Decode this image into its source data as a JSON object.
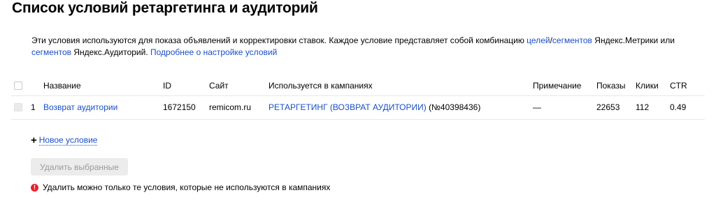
{
  "page": {
    "title": "Список условий ретаргетинга и аудиторий"
  },
  "description": {
    "text1": "Эти условия используются для показа объявлений и корректировки ставок. Каждое условие представляет собой комбинацию ",
    "link_goals": "целей",
    "slash": "/",
    "link_segments_metrika": "сегментов",
    "text2": " Яндекс.Метрики или",
    "link_segments_audience": "сегментов",
    "text3": " Яндекс.Аудиторий. ",
    "link_more": "Подробнее о настройке условий"
  },
  "table": {
    "headers": {
      "name": "Название",
      "id": "ID",
      "site": "Сайт",
      "campaigns": "Используется в кампаниях",
      "note": "Примечание",
      "impressions": "Показы",
      "clicks": "Клики",
      "ctr": "CTR"
    },
    "rows": [
      {
        "num": "1",
        "name": "Возврат аудитории",
        "id": "1672150",
        "site": "remicom.ru",
        "campaign": "РЕТАРГЕТИНГ (ВОЗВРАТ АУДИТОРИИ)",
        "campaign_id": "(№40398436)",
        "note": "—",
        "impressions": "22653",
        "clicks": "112",
        "ctr": "0.49"
      }
    ]
  },
  "actions": {
    "add_icon": "+",
    "add_condition": "Новое условие",
    "delete_selected": "Удалить выбранные"
  },
  "warning": {
    "icon": "!",
    "text": "Удалить можно только те условия, которые не используются в кампаниях"
  },
  "colors": {
    "link": "#1a4fc4",
    "warning": "#e3232b",
    "disabled_button": "#ececec"
  }
}
